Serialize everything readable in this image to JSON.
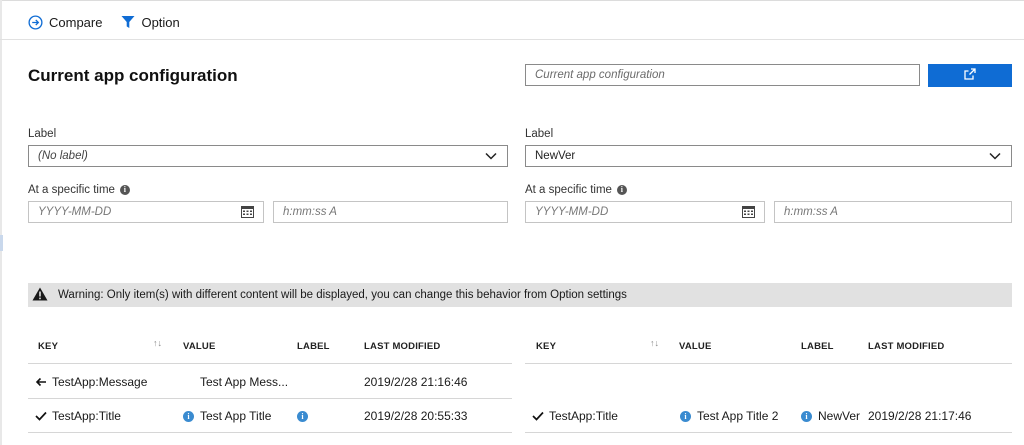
{
  "toolbar": {
    "compare_label": "Compare",
    "option_label": "Option"
  },
  "page": {
    "title": "Current app configuration"
  },
  "compare_target": {
    "placeholder": "Current app configuration"
  },
  "left_panel": {
    "label_title": "Label",
    "label_value": "(No label)",
    "time_title": "At a specific time",
    "date_placeholder": "YYYY-MM-DD",
    "time_placeholder": "h:mm:ss A"
  },
  "right_panel": {
    "label_title": "Label",
    "label_value": "NewVer",
    "time_title": "At a specific time",
    "date_placeholder": "YYYY-MM-DD",
    "time_placeholder": "h:mm:ss A"
  },
  "warning": {
    "text": "Warning: Only item(s) with different content will be displayed, you can change this behavior from Option settings"
  },
  "columns": {
    "key": "KEY",
    "value": "VALUE",
    "label": "LABEL",
    "last_modified": "LAST MODIFIED"
  },
  "left_rows": [
    {
      "status_icon": "arrow-left-icon",
      "key": "TestApp:Message",
      "value": "Test App Mess...",
      "label": "",
      "last_modified": "2019/2/28 21:16:46",
      "has_value_info": false,
      "has_label_info": false
    },
    {
      "status_icon": "checkmark-icon",
      "key": "TestApp:Title",
      "value": "Test App Title",
      "label": "",
      "last_modified": "2019/2/28 20:55:33",
      "has_value_info": true,
      "has_label_info": true
    }
  ],
  "right_rows": [
    {
      "status_icon": "checkmark-icon",
      "key": "TestApp:Title",
      "value": "Test App Title 2",
      "label": "NewVer",
      "last_modified": "2019/2/28 21:17:46",
      "has_value_info": true,
      "has_label_info": true
    }
  ],
  "colors": {
    "accent": "#0f6cd4",
    "info_badge": "#3a8bd0",
    "warning_bg": "#e1e1e1"
  }
}
